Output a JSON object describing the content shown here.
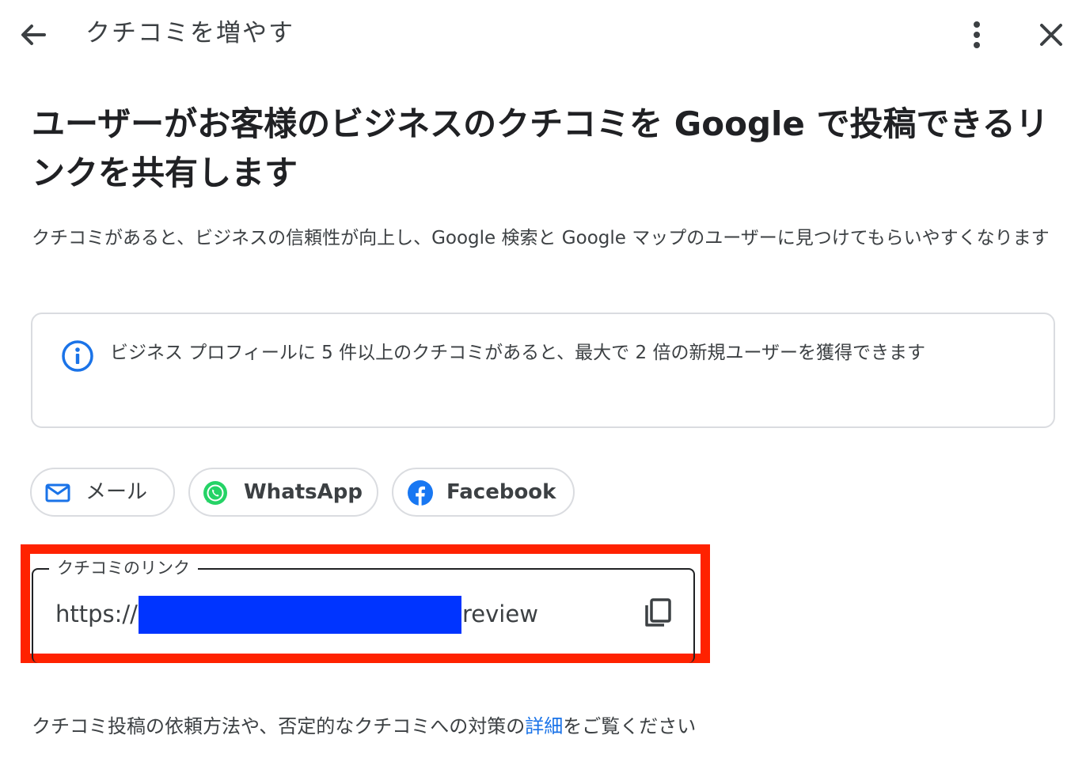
{
  "header": {
    "title": "クチコミを増やす",
    "back_icon": "arrow-left-icon",
    "more_icon": "more-vertical-icon",
    "close_icon": "close-icon"
  },
  "main": {
    "headline": "ユーザーがお客様のビジネスのクチコミを Google で投稿できるリンクを共有します",
    "description": "クチコミがあると、ビジネスの信頼性が向上し、Google 検索と Google マップのユーザーに見つけてもらいやすくなります",
    "info": {
      "icon": "info-icon",
      "text": "ビジネス プロフィールに 5 件以上のクチコミがあると、最大で 2 倍の新規ユーザーを獲得できます"
    },
    "share_buttons": [
      {
        "label": "メール",
        "icon": "mail-icon"
      },
      {
        "label": "WhatsApp",
        "icon": "whatsapp-icon"
      },
      {
        "label": "Facebook",
        "icon": "facebook-icon"
      }
    ],
    "review_link": {
      "legend": "クチコミのリンク",
      "prefix": "https://",
      "suffix": "review",
      "copy_icon": "copy-icon"
    },
    "footer": {
      "text_before": "クチコミ投稿の依頼方法や、否定的なクチコミへの対策の",
      "link": "詳細",
      "text_after": "をご覧ください"
    }
  },
  "colors": {
    "accent": "#1a73e8",
    "highlight": "#ff2200",
    "redaction": "#0034ff",
    "whatsapp": "#25d366",
    "facebook": "#1877f2"
  }
}
